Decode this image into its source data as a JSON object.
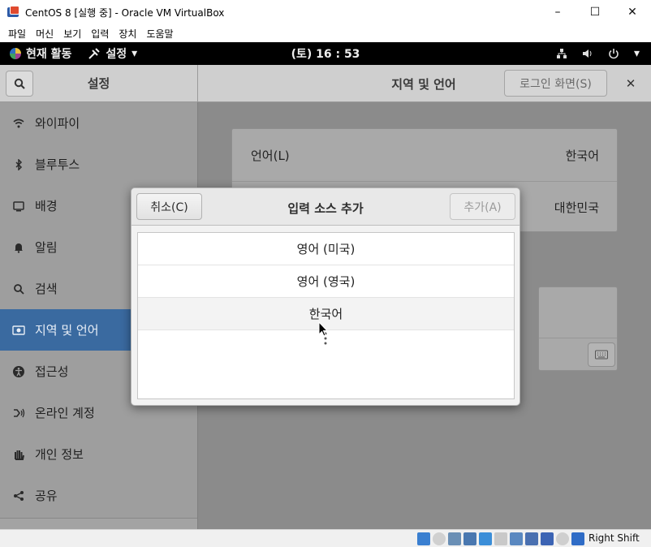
{
  "window": {
    "title": "CentOS 8 [실행 중] - Oracle VM VirtualBox",
    "controls": [
      "–",
      "☐",
      "✕"
    ]
  },
  "vbox_menu": [
    "파일",
    "머신",
    "보기",
    "입력",
    "장치",
    "도움말"
  ],
  "gnome_topbar": {
    "activities": "현재 활동",
    "app_menu": "설정",
    "clock": "(토) 16 : 53"
  },
  "settings": {
    "sidebar_title": "설정",
    "page_title": "지역 및 언어",
    "login_screen_button": "로그인 화면(S)",
    "sidebar_items": [
      {
        "label": "와이파이",
        "icon": "wifi-icon"
      },
      {
        "label": "블루투스",
        "icon": "bluetooth-icon"
      },
      {
        "label": "배경",
        "icon": "background-icon"
      },
      {
        "label": "알림",
        "icon": "bell-icon"
      },
      {
        "label": "검색",
        "icon": "search-icon"
      },
      {
        "label": "지역 및 언어",
        "icon": "region-icon",
        "active": true
      },
      {
        "label": "접근성",
        "icon": "accessibility-icon"
      },
      {
        "label": "온라인 계정",
        "icon": "online-accounts-icon"
      },
      {
        "label": "개인 정보",
        "icon": "privacy-hand-icon"
      },
      {
        "label": "공유",
        "icon": "share-icon"
      }
    ],
    "language_row": {
      "label": "언어(L)",
      "value": "한국어"
    },
    "formats_row": {
      "value": "대한민국"
    }
  },
  "dialog": {
    "title": "입력 소스 추가",
    "cancel": "취소(C)",
    "add": "추가(A)",
    "items": [
      "영어 (미국)",
      "영어 (영국)",
      "한국어"
    ]
  },
  "status_bar": {
    "host_key": "Right Shift"
  },
  "colors": {
    "active_item": "#3a6aa0",
    "dim_overlay": "#8b8b8b",
    "topbar": "#000000"
  }
}
